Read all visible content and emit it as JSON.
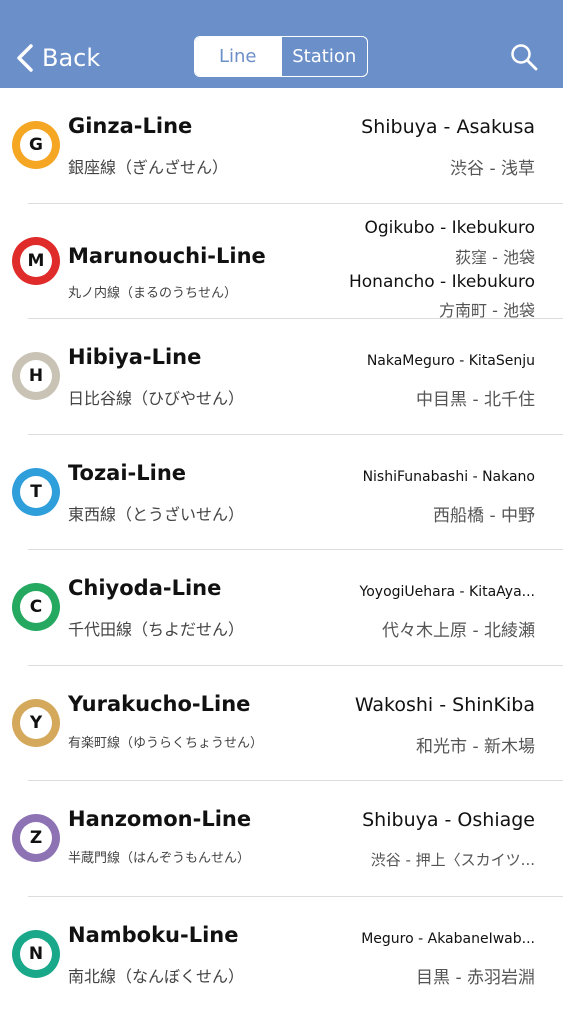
{
  "nav": {
    "back_label": "Back",
    "tab_line": "Line",
    "tab_station": "Station",
    "bar_color": "#6b8fc9"
  },
  "lines": [
    {
      "letter": "G",
      "color": "#f5a623",
      "name": "Ginza-Line",
      "jp": "銀座線（ぎんざせん）",
      "route_en": "Shibuya - Asakusa",
      "route_jp": "渋谷 - 浅草"
    },
    {
      "letter": "M",
      "color": "#e02b2b",
      "name": "Marunouchi-Line",
      "jp": "丸ノ内線（まるのうちせん）",
      "routes": [
        {
          "en": "Ogikubo - Ikebukuro",
          "jp": "荻窪 - 池袋"
        },
        {
          "en": "Honancho - Ikebukuro",
          "jp": "方南町 - 池袋"
        }
      ]
    },
    {
      "letter": "H",
      "color": "#c8c3b5",
      "name": "Hibiya-Line",
      "jp": "日比谷線（ひびやせん）",
      "route_en": "NakaMeguro - KitaSenju",
      "route_jp": "中目黒 - 北千住"
    },
    {
      "letter": "T",
      "color": "#2f9fdc",
      "name": "Tozai-Line",
      "jp": "東西線（とうざいせん）",
      "route_en": "NishiFunabashi - Nakano",
      "route_jp": "西船橋 - 中野"
    },
    {
      "letter": "C",
      "color": "#25a860",
      "name": "Chiyoda-Line",
      "jp": "千代田線（ちよだせん）",
      "route_en": "YoyogiUehara - KitaAya...",
      "route_jp": "代々木上原 - 北綾瀬"
    },
    {
      "letter": "Y",
      "color": "#d4a95c",
      "name": "Yurakucho-Line",
      "jp": "有楽町線（ゆうらくちょうせん）",
      "route_en": "Wakoshi - ShinKiba",
      "route_jp": "和光市 - 新木場"
    },
    {
      "letter": "Z",
      "color": "#8d73b3",
      "name": "Hanzomon-Line",
      "jp": "半蔵門線（はんぞうもんせん）",
      "route_en": "Shibuya - Oshiage",
      "route_jp": "渋谷 - 押上〈スカイツ..."
    },
    {
      "letter": "N",
      "color": "#1aa88a",
      "name": "Namboku-Line",
      "jp": "南北線（なんぼくせん）",
      "route_en": "Meguro - AkabaneIwab...",
      "route_jp": "目黒 - 赤羽岩淵"
    }
  ]
}
